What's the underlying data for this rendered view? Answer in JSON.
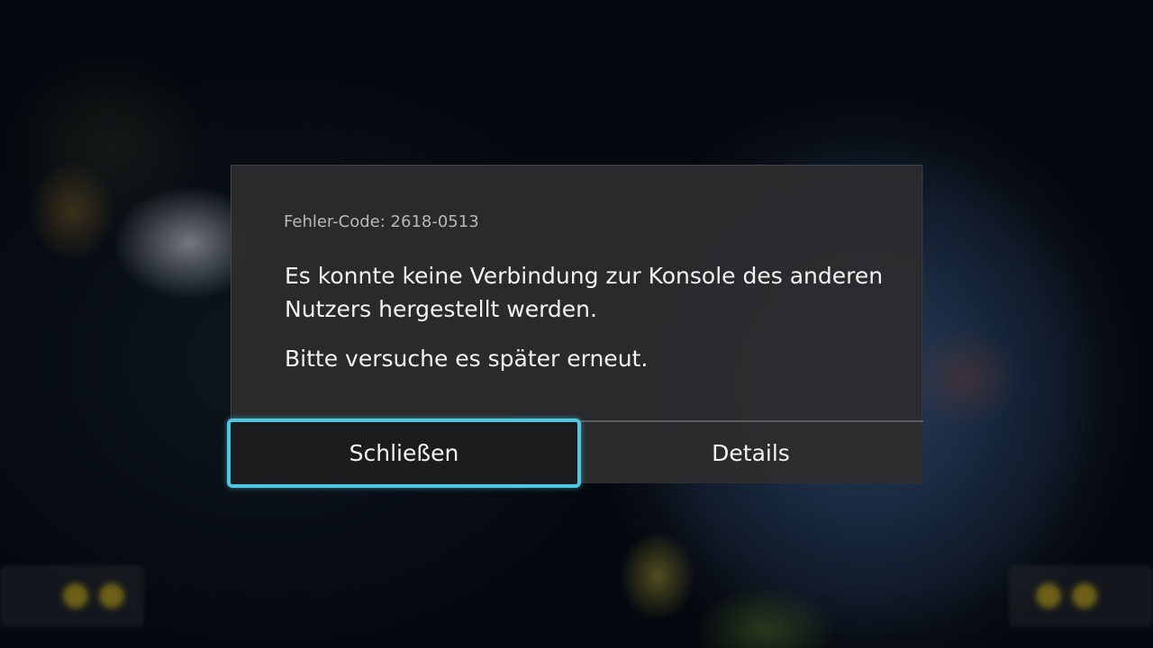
{
  "dialog": {
    "error_code": "Fehler-Code: 2618-0513",
    "message_line1": "Es konnte keine Verbindung zur Konsole des anderen",
    "message_line2": "Nutzers hergestellt werden.",
    "message_secondary": "Bitte versuche es später erneut.",
    "buttons": {
      "close": "Schließen",
      "details": "Details"
    },
    "focus_color": "#4fc7e2"
  }
}
